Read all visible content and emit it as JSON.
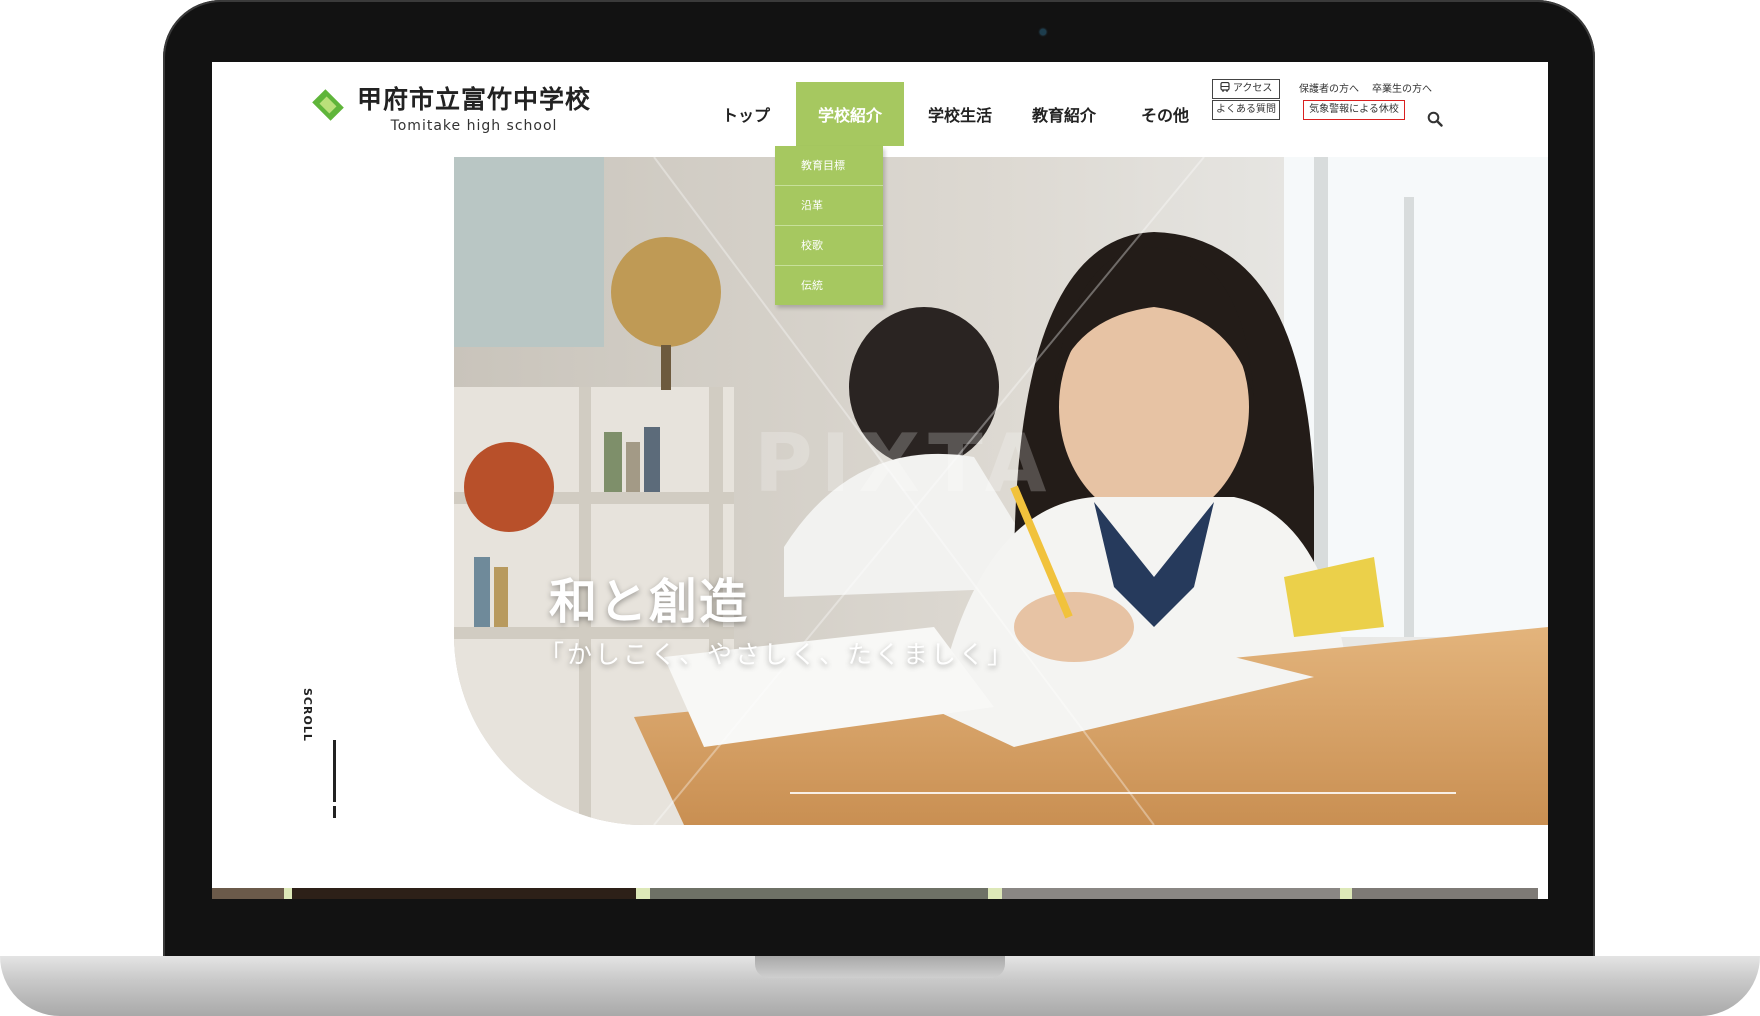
{
  "site": {
    "name": "甲府市立富竹中学校",
    "name_en": "Tomitake high school"
  },
  "nav": {
    "items": [
      {
        "label": "トップ"
      },
      {
        "label": "学校紹介"
      },
      {
        "label": "学校生活"
      },
      {
        "label": "教育紹介"
      },
      {
        "label": "その他"
      }
    ],
    "dropdown": [
      "教育目標",
      "沿革",
      "校歌",
      "伝統"
    ]
  },
  "utility": {
    "access": "アクセス",
    "faq": "よくある質問",
    "parents": "保護者の方へ",
    "graduates": "卒業生の方へ",
    "weather_closure": "気象警報による休校"
  },
  "hero": {
    "title": "和と創造",
    "subtitle": "「かしこく、やさしく、たくましく」",
    "watermark": "PIXTA"
  },
  "scroll": {
    "label": "SCROLL"
  },
  "colors": {
    "accent_green": "#a6c860",
    "logo_green": "#5fb53a",
    "alert_red": "#d92020"
  },
  "icons": [
    "bus-icon",
    "search-icon",
    "logo-diamond-icon"
  ]
}
